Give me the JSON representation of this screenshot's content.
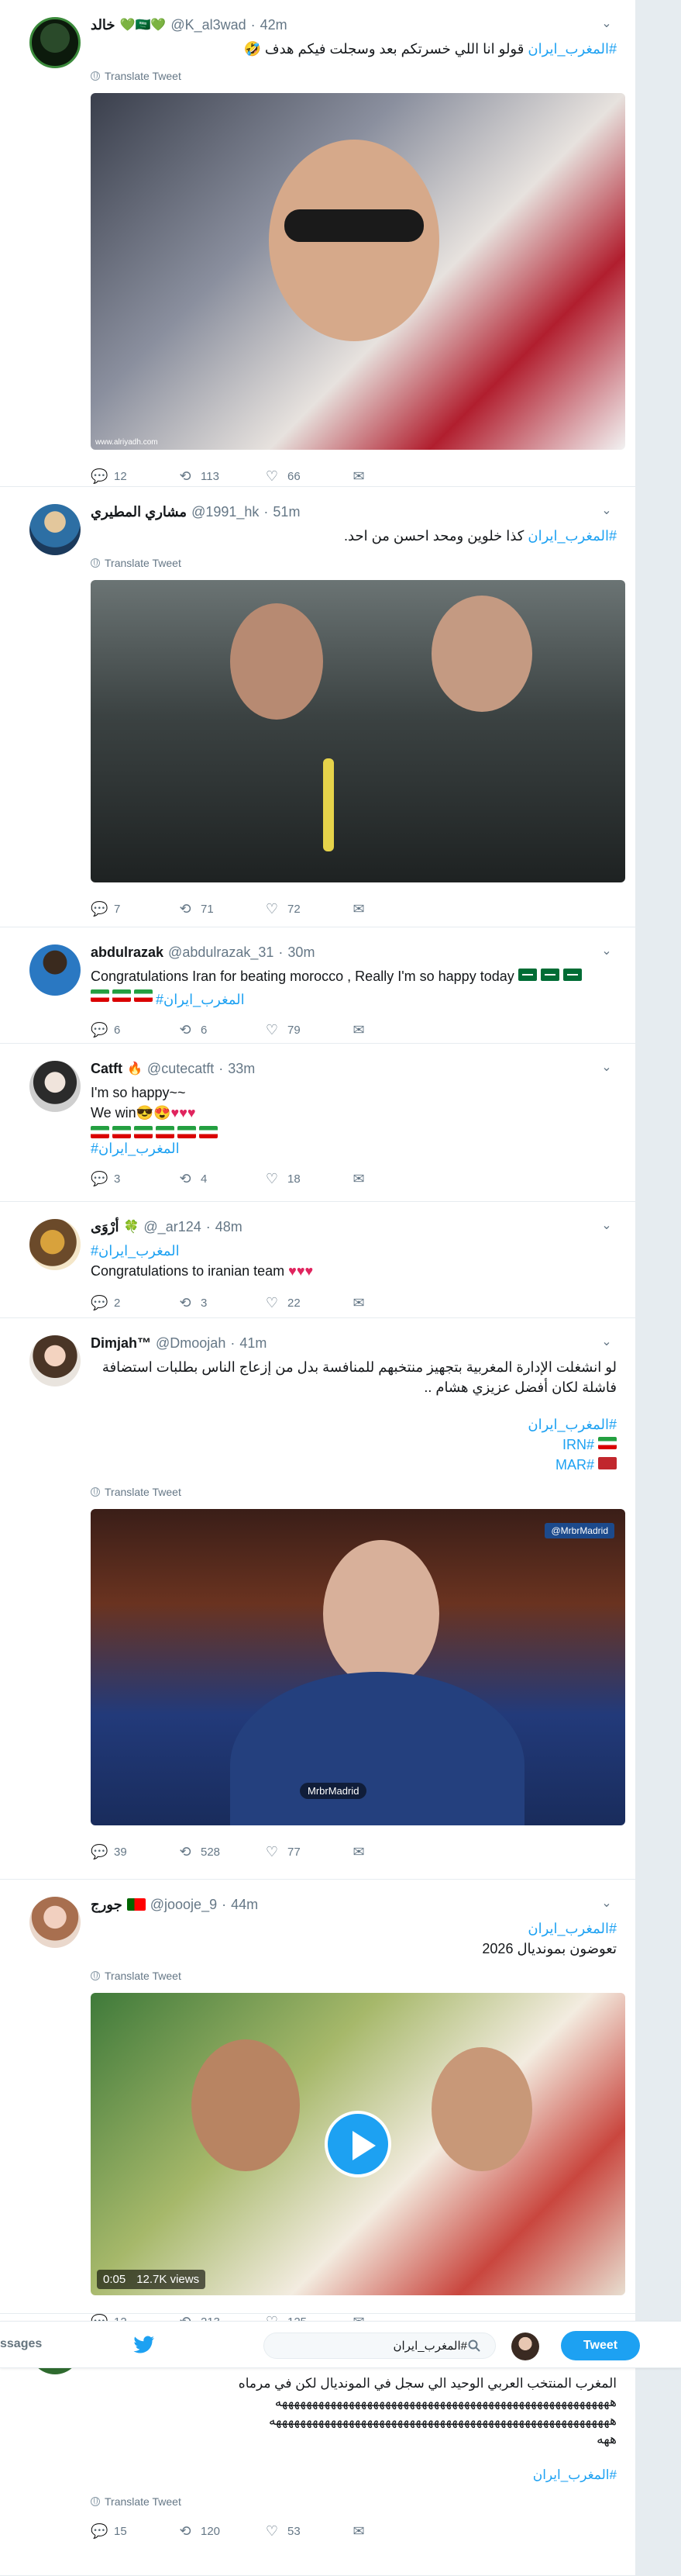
{
  "colors": {
    "accent": "#1da1f2",
    "muted": "#657786",
    "heart": "#e0245e"
  },
  "tweets": [
    {
      "name": "خالد",
      "badges": "💚🇸🇦💚",
      "handle": "@K_al3wad",
      "time": "42m",
      "text_rtl": true,
      "hashtag": "#المغرب_ايران",
      "text": "قولو انا اللي خسرتكم بعد وسجلت فيكم هدف 🤣",
      "translate": "Translate Tweet",
      "watermark": "www.alriyadh.com",
      "replies": "12",
      "retweets": "113",
      "likes": "66"
    },
    {
      "name": "مشاري المطيري",
      "handle": "@1991_hk",
      "time": "51m",
      "hashtag": "#المغرب_ايران",
      "text": "كذا خلوين ومحد احسن من احد.",
      "translate": "Translate Tweet",
      "replies": "7",
      "retweets": "71",
      "likes": "72"
    },
    {
      "name": "abdulrazak",
      "handle": "@abdulrazak_31",
      "time": "30m",
      "text": "Congratulations Iran for beating morocco , Really I'm so happy today",
      "hashtag": "#المغرب_ايران",
      "replies": "6",
      "retweets": "6",
      "likes": "79"
    },
    {
      "name": "Catft",
      "name_emoji": "🔥",
      "handle": "@cutecatft",
      "time": "33m",
      "line1": "I'm so happy~~",
      "line2": "We win😎😍",
      "hearts": "♥♥♥",
      "hashtag": "#المغرب_ايران",
      "replies": "3",
      "retweets": "4",
      "likes": "18"
    },
    {
      "name": "أرْوَى",
      "name_emoji": "🍀",
      "handle": "@_ar124",
      "time": "48m",
      "hashtag": "#المغرب_ايران",
      "text": "Congratulations to iranian team",
      "hearts": "♥♥♥",
      "replies": "2",
      "retweets": "3",
      "likes": "22"
    },
    {
      "name": "Dimjah™",
      "handle": "@Dmoojah",
      "time": "41m",
      "text": "لو انشغلت الإدارة المغربية بتجهيز منتخبهم للمنافسة بدل من إزعاج الناس بطلبات استضافة فاشلة لكان أفضل عزيزي هشام ..",
      "hashtag": "#المغرب_ايران",
      "tag2": "#IRN",
      "tag3": "#MAR",
      "translate": "Translate Tweet",
      "tv_logo": "@MrbrMadrid",
      "tv_tag": "MrbrMadrid",
      "replies": "39",
      "retweets": "528",
      "likes": "77"
    },
    {
      "name": "جورج",
      "handle": "@joooje_9",
      "time": "44m",
      "hashtag": "#المغرب_ايران",
      "text": "تعوضون بمونديال 2026",
      "translate": "Translate Tweet",
      "video_time": "0:05",
      "video_views": "12.7K views",
      "replies": "12",
      "retweets": "213",
      "likes": "125"
    },
    {
      "text": "المغرب المنتخب العربي الوحيد الي سجل في المونديال لكن في مرماه",
      "laugh": "هههههههههههههههههههههههههههههههههههههههههههههههههههههههه",
      "laugh2": "ههههههههههههههههههههههههههههههههههههههههههههههههههههههههه",
      "laugh3": "ههه",
      "hashtag": "#المغرب_ايران",
      "translate": "Translate Tweet",
      "replies": "15",
      "retweets": "120",
      "likes": "53"
    }
  ],
  "topbar": {
    "messages_label": "ssages",
    "search_value": "#المغرب_ايران",
    "tweet_button": "Tweet"
  }
}
